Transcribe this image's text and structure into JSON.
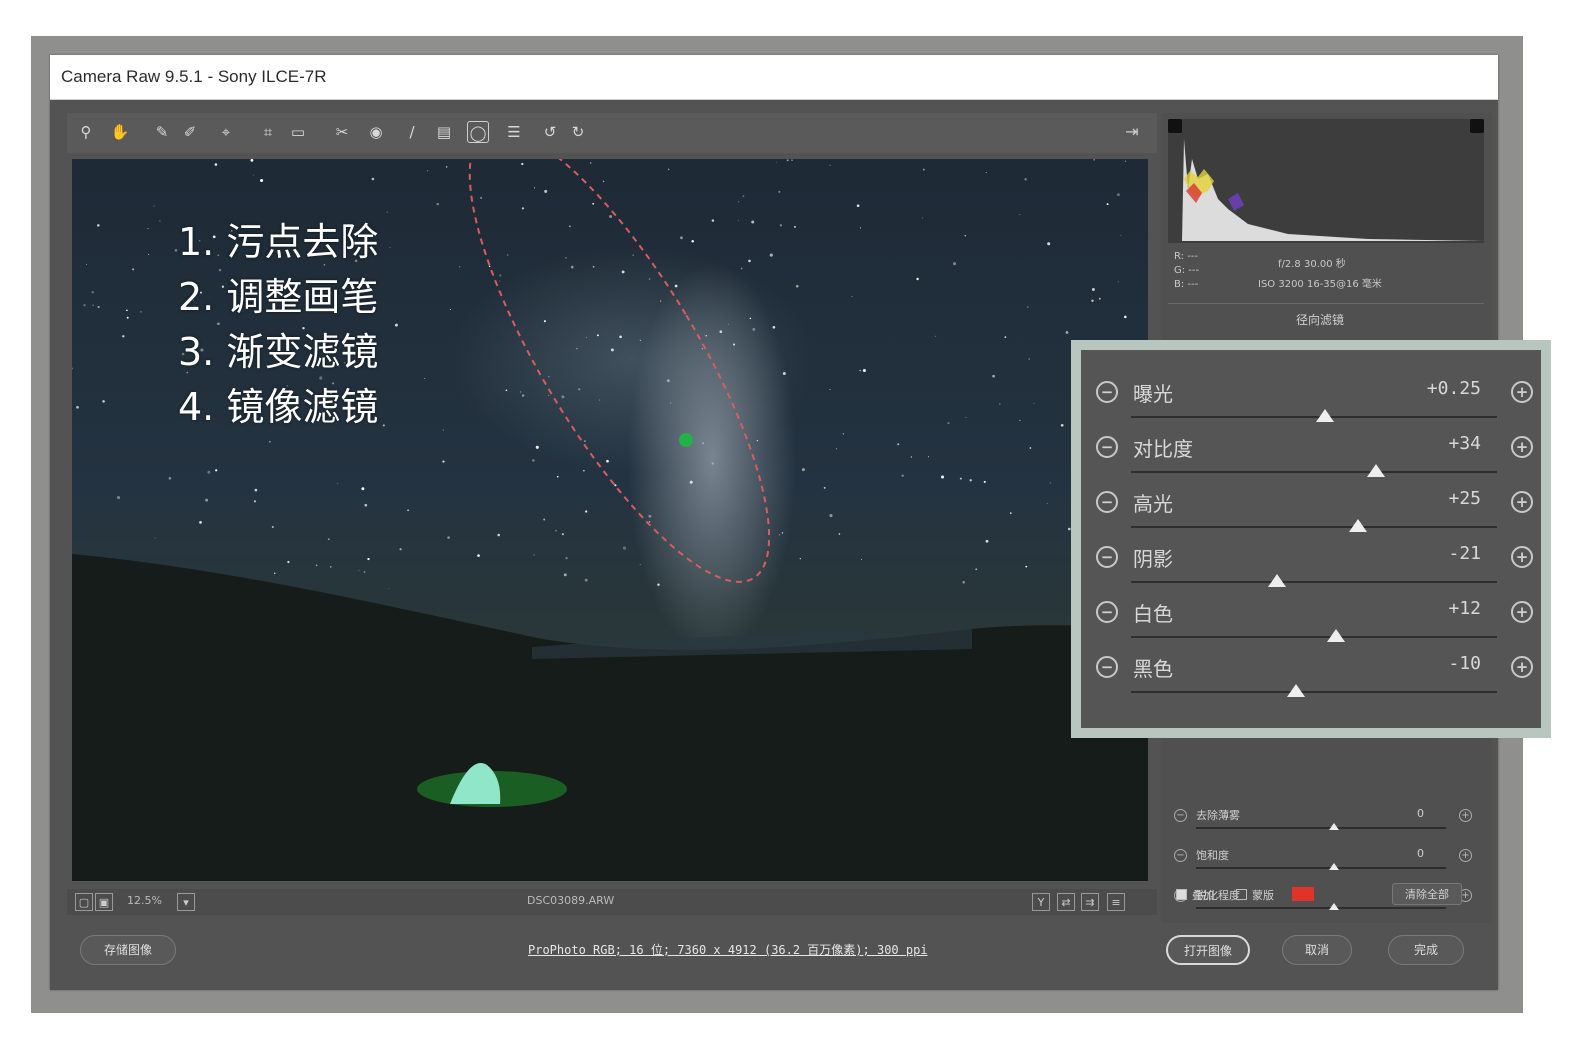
{
  "window": {
    "title": "Camera Raw 9.5.1 -  Sony ILCE-7R"
  },
  "toolbar": {
    "tools": [
      {
        "name": "zoom-tool-icon",
        "glyph": "⚲"
      },
      {
        "name": "hand-tool-icon",
        "glyph": "✋"
      },
      {
        "name": "white-balance-tool-icon",
        "glyph": "✎"
      },
      {
        "name": "color-sampler-tool-icon",
        "glyph": "✐"
      },
      {
        "name": "targeted-adjustment-tool-icon",
        "glyph": "⌖"
      },
      {
        "name": "crop-tool-icon",
        "glyph": "⌗"
      },
      {
        "name": "straighten-tool-icon",
        "glyph": "▭"
      },
      {
        "name": "spot-removal-tool-icon",
        "glyph": "✂"
      },
      {
        "name": "red-eye-tool-icon",
        "glyph": "◉"
      },
      {
        "name": "adjustment-brush-icon",
        "glyph": "/"
      },
      {
        "name": "graduated-filter-icon",
        "glyph": "▤"
      },
      {
        "name": "radial-filter-icon",
        "glyph": "◯"
      },
      {
        "name": "preferences-icon",
        "glyph": "☰"
      },
      {
        "name": "rotate-left-icon",
        "glyph": "↺"
      },
      {
        "name": "rotate-right-icon",
        "glyph": "↻"
      }
    ],
    "exit_glyph": "⇥"
  },
  "overlay": {
    "lines": [
      "1. 污点去除",
      "2. 调整画笔",
      "3. 渐变滤镜",
      "4. 镜像滤镜"
    ]
  },
  "status": {
    "zoom": "12.5%",
    "filename": "DSC03089.ARW"
  },
  "histogram_info": {
    "r": "R: ---",
    "g": "G: ---",
    "b": "B: ---",
    "line1": "f/2.8   30.00 秒",
    "line2": "ISO 3200   16-35@16 毫米",
    "panel_title": "径向滤镜"
  },
  "callout": {
    "adjustments": [
      {
        "label": "曝光",
        "value": "+0.25",
        "pos": 0.53
      },
      {
        "label": "对比度",
        "value": "+34",
        "pos": 0.67
      },
      {
        "label": "高光",
        "value": "+25",
        "pos": 0.62
      },
      {
        "label": "阴影",
        "value": "-21",
        "pos": 0.4
      },
      {
        "label": "白色",
        "value": "+12",
        "pos": 0.56
      },
      {
        "label": "黑色",
        "value": "-10",
        "pos": 0.45
      }
    ]
  },
  "lower_panel": {
    "rows": [
      {
        "label": "去除薄雾",
        "value": "0",
        "pos": 0.55
      },
      {
        "label": "饱和度",
        "value": "0",
        "pos": 0.55
      },
      {
        "label": "锐化程度",
        "value": "0",
        "pos": 0.55
      }
    ],
    "overlay_label": "叠加",
    "mask_label": "蒙版",
    "clear_all": "清除全部",
    "mask_color": "#e03428"
  },
  "footer": {
    "save_image": "存储图像",
    "workflow": "ProPhoto RGB; 16 位; 7360 x 4912 (36.2 百万像素); 300 ppi",
    "open_image": "打开图像",
    "cancel": "取消",
    "done": "完成"
  }
}
